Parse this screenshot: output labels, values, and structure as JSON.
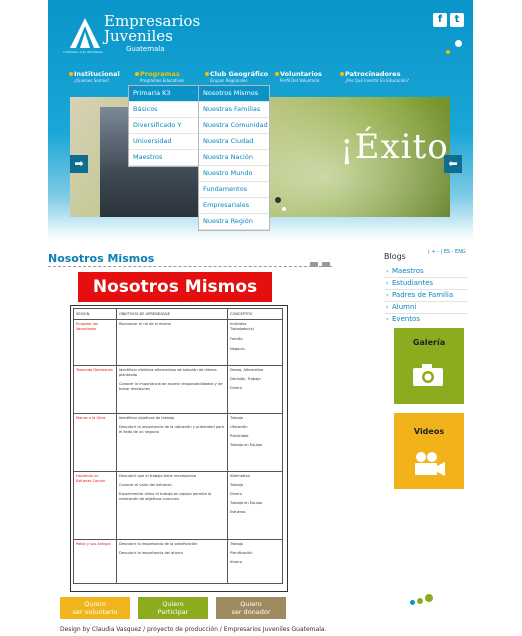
{
  "header": {
    "logo_line1": "Empresarios",
    "logo_line2": "Juveniles",
    "logo_country": "Guatemala",
    "logo_tagline": "A Member of JA Worldwide",
    "social": [
      {
        "icon": "facebook-icon",
        "glyph": "f"
      },
      {
        "icon": "twitter-icon",
        "glyph": "t"
      }
    ],
    "banner_text": "¡Éxito!"
  },
  "nav": [
    {
      "title": "Institucional",
      "subtitle": "¿Quienes Somos?"
    },
    {
      "title": "Programas",
      "subtitle": "Programas Educativos"
    },
    {
      "title": "Club Geográfico",
      "subtitle": "Grupos Regionales"
    },
    {
      "title": "Voluntarios",
      "subtitle": "Perfil Del Voluntario"
    },
    {
      "title": "Patrocinadores",
      "subtitle": "¿Por Qué Invertir En Educación?"
    }
  ],
  "dropdown_primary": [
    "Primaria K3",
    "Básicos",
    "Diversificado Y",
    "Universidad",
    "Maestros"
  ],
  "dropdown_secondary": [
    "Nosotros Mismos",
    "Nuestras Familias",
    "Nuestra Comunidad",
    "Nuestra Ciudad",
    "Nuestra Nación",
    "Nuestro Mundo",
    "Fundamentos",
    "Empresariales",
    "Nuestra Región"
  ],
  "main": {
    "title": "Nosotros Mismos",
    "banner": "Nosotros Mismos",
    "table_headers": [
      "SESION",
      "OBJETIVOS DE APRENDIZAJE",
      "CONCEPTOS"
    ],
    "rows": [
      {
        "session": "Empezar las Vacaciones",
        "objectives": [
          "Reconocer el rol de si mismo"
        ],
        "concepts": [
          "Individuo",
          "Trabajador(a)",
          "Familia",
          "Negocio"
        ]
      },
      {
        "session": "Tomando Decisiones",
        "objectives": [
          "Identificar distintas alternativas de solución de dilema planteado",
          "Conocer la importancia de asumir responsabilidades y de tomar decisiones"
        ],
        "concepts": [
          "Deseo, Alternativa",
          "Decisión, Trabajo",
          "Dinero"
        ]
      },
      {
        "session": "Manos a la Obra",
        "objectives": [
          "Identificar objetivos de trabajo",
          "Descubrir la importancia de la ubicación y publicidad para el éxito de un negocio"
        ],
        "concepts": [
          "Trabajo",
          "Ubicación",
          "Publicidad",
          "Trabajo en Equipo"
        ]
      },
      {
        "session": "Haciendo un Esfuerzo Común",
        "objectives": [
          "Descubrir que el trabajo tiene recompensa",
          "Conocer el valor del esfuerzo",
          "Experimentar cómo el trabajo en equipo permite la realización de objetivos comunes"
        ],
        "concepts": [
          "Alternativa",
          "Trabajo",
          "Dinero",
          "Trabajo en Equipo",
          "Esfuerzo"
        ]
      },
      {
        "session": "Pablo y sus Amigos",
        "objectives": [
          "Descubrir la importancia de la planificación",
          "Descubrir la importancia del ahorro"
        ],
        "concepts": [
          "Trabajo",
          "Planificación",
          "Ahorro"
        ]
      }
    ]
  },
  "sidebar": {
    "heading": "Blogs",
    "font_size_controls": "| + - | ES - ENG",
    "links": [
      "Maestros",
      "Estudiantes",
      "Padres de Familia",
      "Alumni",
      "Eventos"
    ],
    "tiles": [
      {
        "label": "Galería",
        "icon": "camera-icon",
        "color": "#8cab1e"
      },
      {
        "label": "Videos",
        "icon": "video-camera-icon",
        "color": "#f2b21a"
      }
    ]
  },
  "bottom_buttons": [
    {
      "line1": "Quiero",
      "line2": "ser voluntario",
      "color": "#f0b51c"
    },
    {
      "line1": "Quiero",
      "line2": "Participar",
      "color": "#8cab1e"
    },
    {
      "line1": "Quiero",
      "line2": "ser donador",
      "color": "#9d8b5f"
    }
  ],
  "footer": "Design by Claudia Vasquez / proyecto de producción / Empresarios Juveniles Guatemala."
}
